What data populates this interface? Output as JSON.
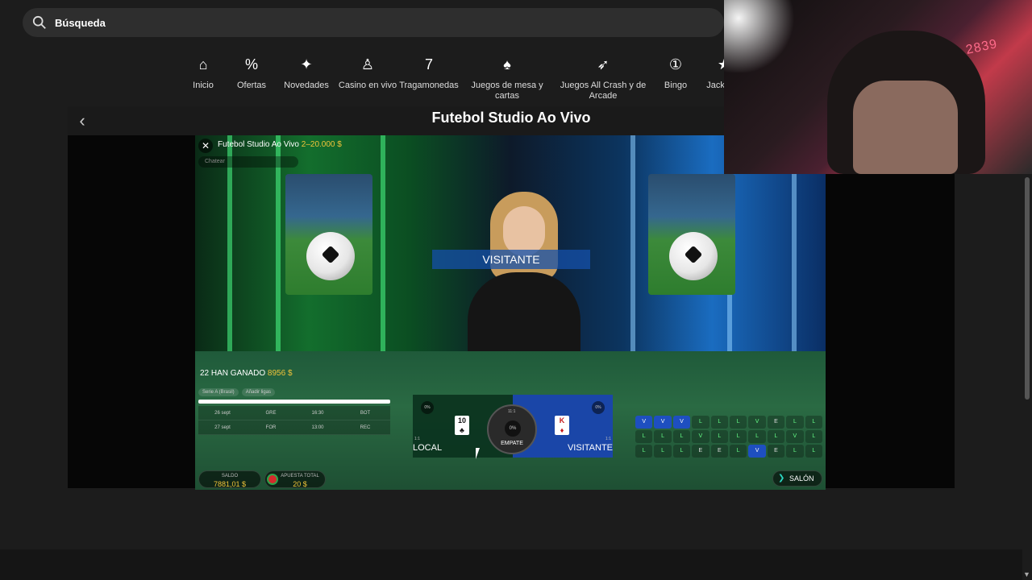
{
  "search": {
    "label": "Búsqueda",
    "icon": "search-icon"
  },
  "categories": [
    {
      "label": "Inicio",
      "icon": "home-icon",
      "glyph": "⌂"
    },
    {
      "label": "Ofertas",
      "icon": "percent-icon",
      "glyph": "%"
    },
    {
      "label": "Novedades",
      "icon": "sparkle-icon",
      "glyph": "✦"
    },
    {
      "label": "Casino en vivo",
      "icon": "dealer-icon",
      "glyph": "♙"
    },
    {
      "label": "Tragamonedas",
      "icon": "slot-seven-icon",
      "glyph": "7"
    },
    {
      "label": "Juegos de mesa y cartas",
      "icon": "cards-icon",
      "glyph": "♠"
    },
    {
      "label": "Juegos All Crash y de Arcade",
      "icon": "rocket-icon",
      "glyph": "➶"
    },
    {
      "label": "Bingo",
      "icon": "bingo-ball-icon",
      "glyph": "①"
    },
    {
      "label": "Jackpots",
      "icon": "star-icon",
      "glyph": "★"
    }
  ],
  "game": {
    "title": "Futebol Studio Ao Vivo",
    "back_icon": "chevron-left-icon",
    "overlay_title": "Futebol Studio Ao Vivo",
    "limits": "2–20.000 $",
    "chat_placeholder": "Chatear",
    "result_banner": "VISITANTE",
    "winners_text": "22 HAN GANADO",
    "winners_amount": "8956 $",
    "sidebet_tabs": [
      "Serie A (Brasil)",
      "Añadir ligas"
    ],
    "sidebet_rows": [
      [
        "26 sept",
        "GRE",
        "16:30",
        "BOT"
      ],
      [
        "27 sept",
        "FOR",
        "13:00",
        "REC"
      ]
    ],
    "bets": {
      "local_label": "LOCAL",
      "visit_label": "VISITANTE",
      "draw_label": "EMPATE",
      "local_pct": "0%",
      "visit_pct": "0%",
      "draw_pct": "0%",
      "local_payout": "1:1",
      "visit_payout": "1:1",
      "draw_payout": "11:1",
      "local_card": "10",
      "local_card_suit": "♣",
      "visit_card": "K",
      "visit_card_suit": "♦"
    },
    "road": [
      [
        "V",
        "V",
        "V",
        "L",
        "L",
        "L",
        "V",
        "E",
        "L",
        "L"
      ],
      [
        "L",
        "L",
        "L",
        "V",
        "L",
        "L",
        "L",
        "L",
        "V",
        "L"
      ],
      [
        "L",
        "L",
        "L",
        "E",
        "E",
        "L",
        "V",
        "E",
        "L",
        "L"
      ]
    ],
    "balance_label": "SALDO",
    "balance_value": "7881,01 $",
    "total_bet_label": "APUESTA TOTAL",
    "total_bet_value": "20 $",
    "lobby_label": "SALÓN"
  },
  "webcam": {
    "neon_text": "2839"
  },
  "colors": {
    "accent_gold": "#f0c43a",
    "visitor_blue": "#1a46a8",
    "local_green": "#0a321e",
    "lobby_teal": "#2cd7c2"
  }
}
